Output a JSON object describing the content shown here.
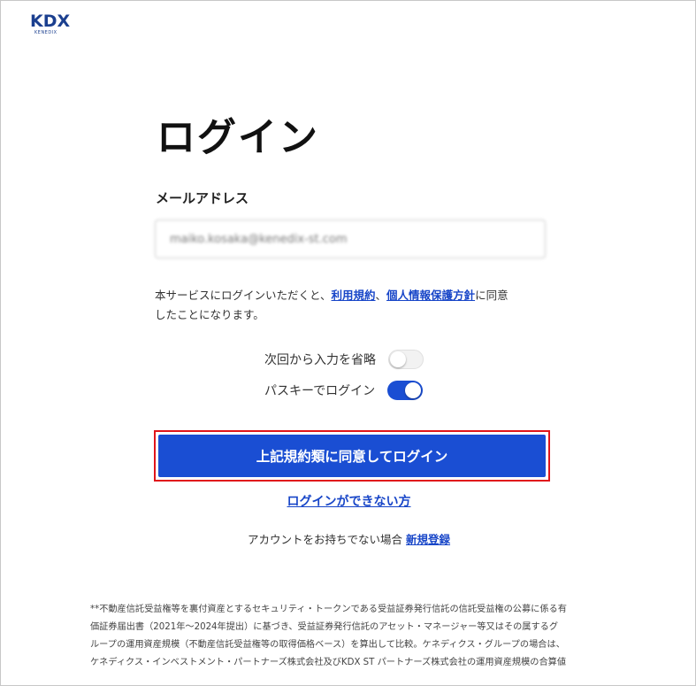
{
  "logo": {
    "main": "KDX",
    "sub": "KENEDIX"
  },
  "page": {
    "title": "ログイン"
  },
  "email": {
    "label": "メールアドレス",
    "value": "maiko.kosaka@kenedix-st.com"
  },
  "terms": {
    "text_before": "本サービスにログインいただくと、",
    "link_terms": "利用規約",
    "separator": "、",
    "link_privacy": "個人情報保護方針",
    "text_after_line1": "に同意",
    "text_line2": "したことになります。"
  },
  "toggles": {
    "remember_label": "次回から入力を省略",
    "remember_on": false,
    "passkey_label": "パスキーでログイン",
    "passkey_on": true
  },
  "colors": {
    "accent": "#1a4ed3",
    "link": "#1846c8",
    "highlight": "#e0151b"
  },
  "actions": {
    "login_button": "上記規約類に同意してログイン",
    "cannot_login_link": "ログインができない方",
    "signup_prompt": "アカウントをお持ちでない場合",
    "signup_link": "新規登録"
  },
  "footnote": {
    "line1": "**不動産信託受益権等を裏付資産とするセキュリティ・トークンである受益証券発行信託の信託受益権の公募に係る有",
    "line2": "価証券届出書（2021年〜2024年提出）に基づき、受益証券発行信託のアセット・マネージャー等又はその属するグ",
    "line3": "ループの運用資産規模（不動産信託受益権等の取得価格ベース）を算出して比較。ケネディクス・グループの場合は、",
    "line4": "ケネディクス・インベストメント・パートナーズ株式会社及びKDX ST パートナーズ株式会社の運用資産規模の合算値"
  }
}
